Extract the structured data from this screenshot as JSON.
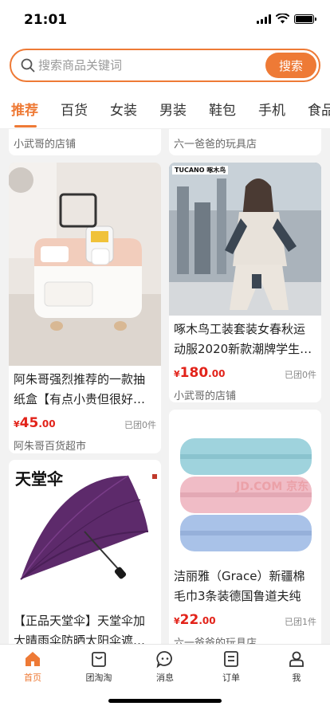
{
  "status": {
    "time": "21:01"
  },
  "search": {
    "placeholder": "搜索商品关键词",
    "button_label": "搜索"
  },
  "categories": [
    "推荐",
    "百货",
    "女装",
    "男装",
    "鞋包",
    "手机",
    "食品"
  ],
  "active_category": "推荐",
  "partial_cards": [
    {
      "shop": "小武哥的店铺"
    },
    {
      "shop": "六一爸爸的玩具店"
    }
  ],
  "products": [
    {
      "title": "阿朱哥强烈推荐的一款抽纸盒【有点小贵但很好…",
      "price_symbol": "¥",
      "price_int": "45",
      "price_dec": ".00",
      "sold": "已团0件",
      "shop": "阿朱哥百货超市"
    },
    {
      "image_text": "TUCANO 啄木鸟",
      "title": "啄木鸟工装套装女春秋运动服2020新款潮牌学生…",
      "price_symbol": "¥",
      "price_int": "180",
      "price_dec": ".00",
      "sold": "已团0件",
      "shop": "小武哥的店铺"
    },
    {
      "image_text": "天堂伞",
      "title": "【正品天堂伞】天堂伞加大晴雨伞防晒太阳伞遮…",
      "price_symbol": "¥",
      "price_int": "",
      "price_dec": "",
      "sold": "",
      "shop": ""
    },
    {
      "image_text": "JD.COM 京东",
      "title": "洁丽雅（Grace）新疆棉毛巾3条装德国鲁道夫纯棉…",
      "price_symbol": "¥",
      "price_int": "22",
      "price_dec": ".00",
      "sold": "已团1件",
      "shop": "六一爸爸的玩具店"
    }
  ],
  "tabbar": [
    {
      "label": "首页",
      "icon": "home-icon",
      "active": true
    },
    {
      "label": "团淘淘",
      "icon": "bag-icon",
      "active": false
    },
    {
      "label": "消息",
      "icon": "message-icon",
      "active": false
    },
    {
      "label": "订单",
      "icon": "order-icon",
      "active": false
    },
    {
      "label": "我",
      "icon": "user-icon",
      "active": false
    }
  ],
  "colors": {
    "accent": "#ee7a36",
    "price": "#e2231a"
  }
}
